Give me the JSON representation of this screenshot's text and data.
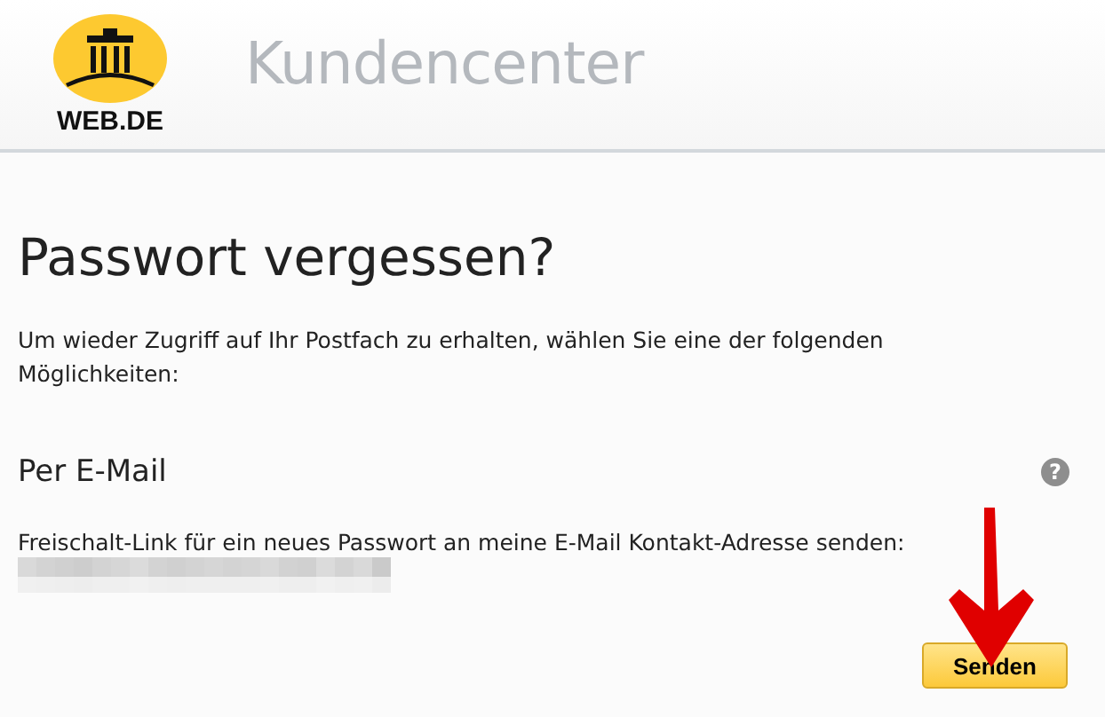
{
  "header": {
    "logo_text": "WEB.DE",
    "title": "Kundencenter"
  },
  "heading": "Passwort vergessen?",
  "intro": "Um wieder Zugriff auf Ihr Postfach zu erhalten, wählen Sie eine der folgenden Möglichkeiten:",
  "option": {
    "title": "Per E-Mail",
    "description": "Freischalt-Link für ein neues Passwort an meine E-Mail Kontakt-Adresse senden:",
    "help": "?"
  },
  "button": {
    "label": "Senden"
  }
}
